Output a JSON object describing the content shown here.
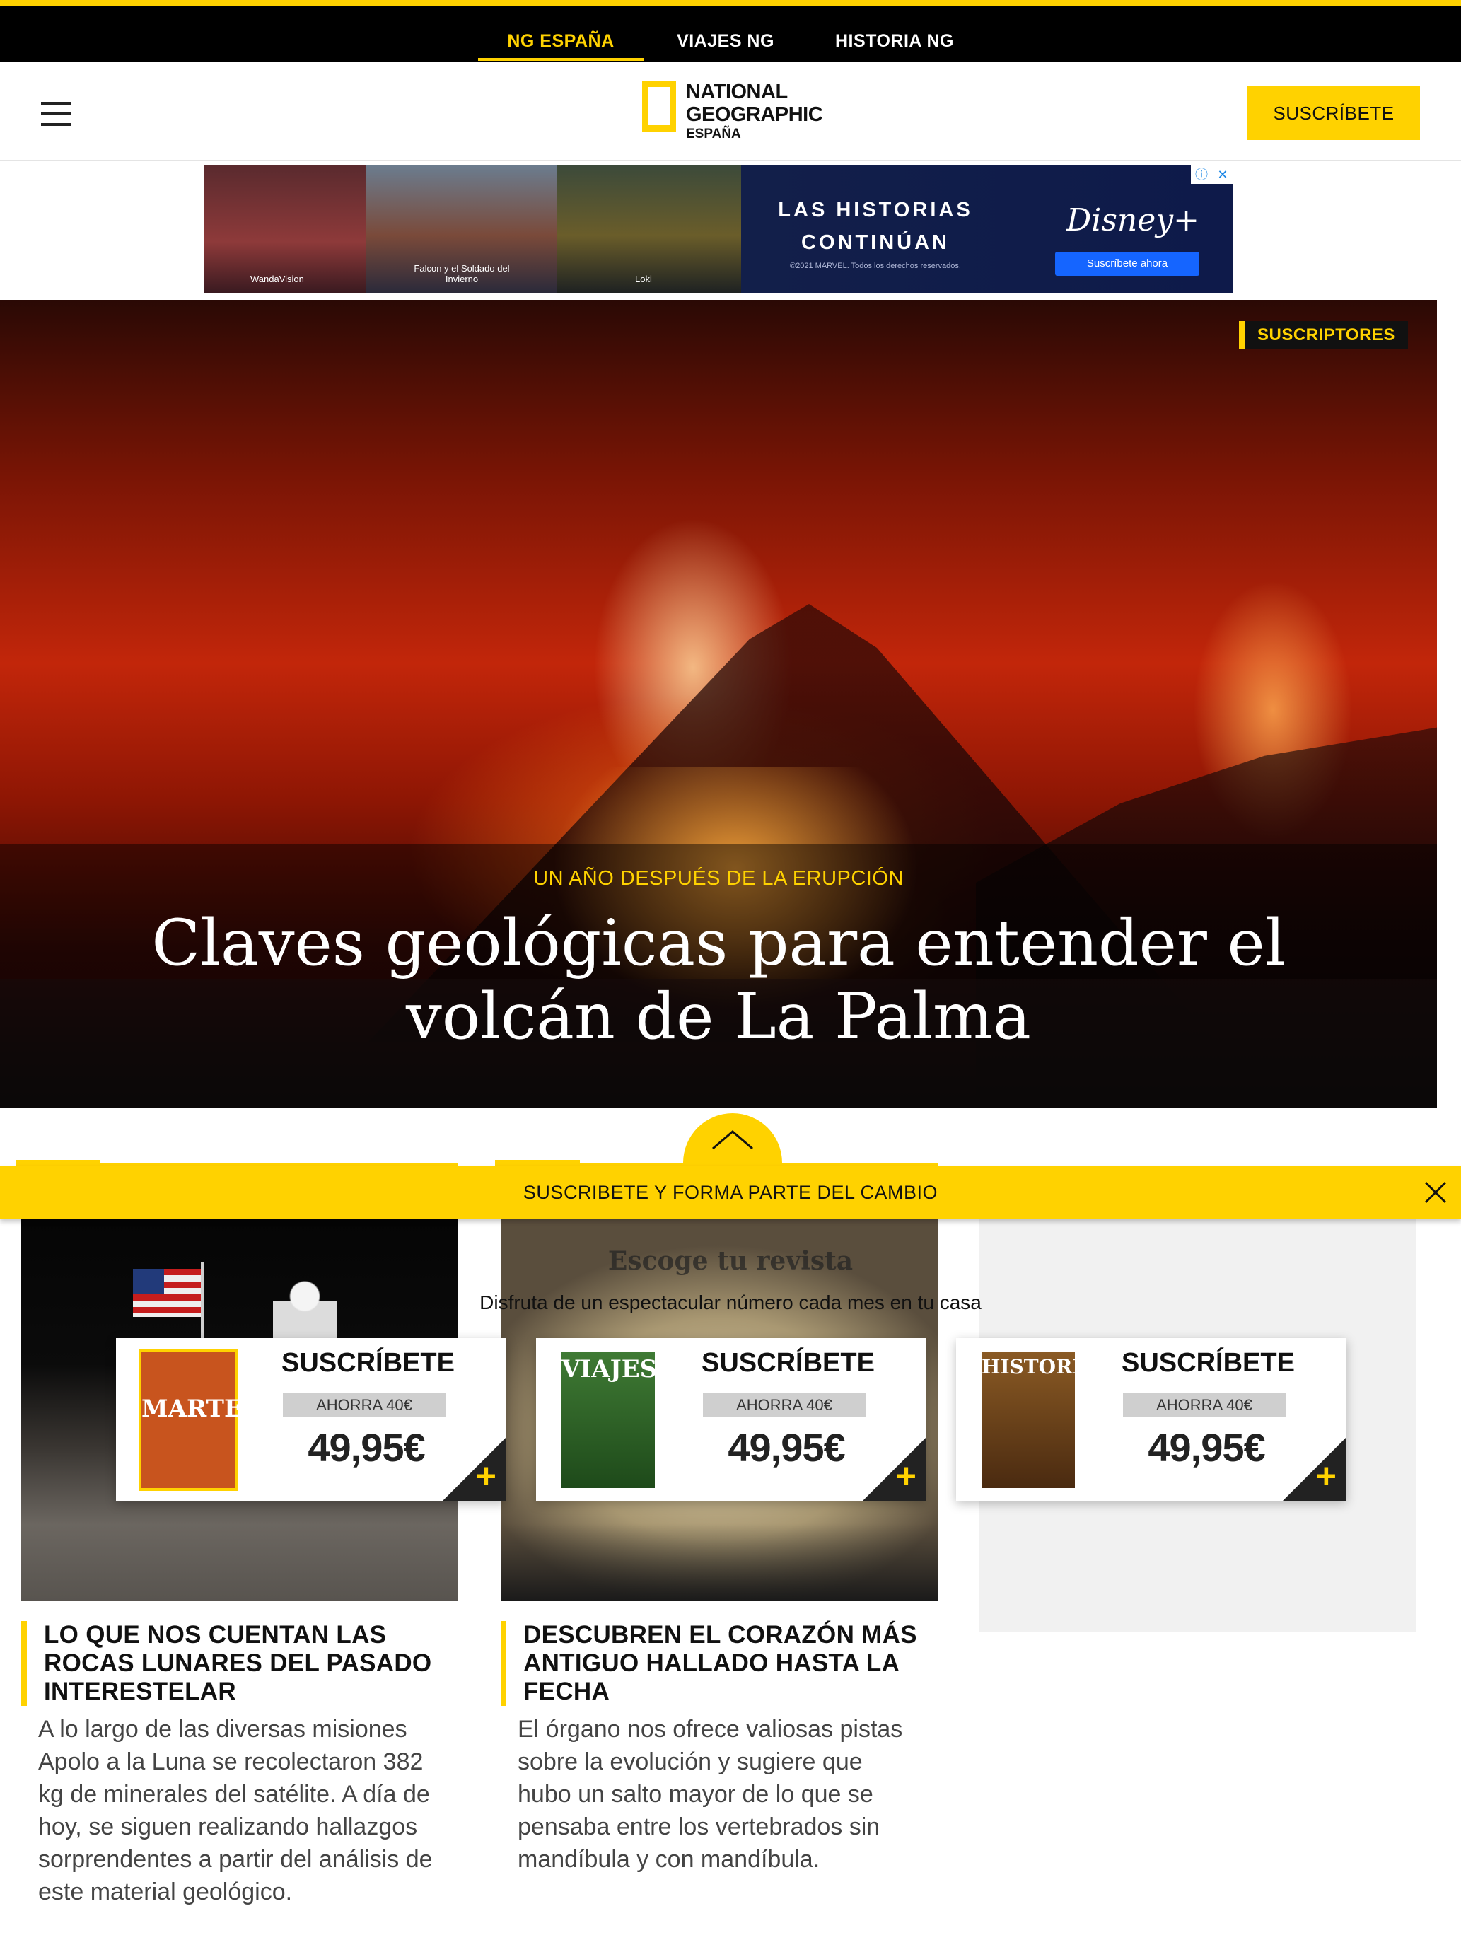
{
  "topbar": {
    "items": [
      {
        "label": "NG ESPAÑA",
        "active": true
      },
      {
        "label": "VIAJES NG",
        "active": false
      },
      {
        "label": "HISTORIA NG",
        "active": false
      }
    ]
  },
  "header": {
    "logo": {
      "line1": "NATIONAL",
      "line2": "GEOGRAPHIC",
      "line3": "ESPAÑA"
    },
    "subscribe_label": "SUSCRÍBETE"
  },
  "ad": {
    "captions": [
      "WandaVision",
      "Falcon y el Soldado del Invierno",
      "Loki"
    ],
    "headline": "LAS HISTORIAS CONTINÚAN",
    "legal": "©2021 MARVEL. Todos los derechos reservados.",
    "brand": "Disney+",
    "cta": "Suscríbete ahora"
  },
  "hero": {
    "badge": "SUSCRIPTORES",
    "kicker": "UN AÑO DESPUÉS DE LA ERUPCIÓN",
    "title": "Claves geológicas para entender el volcán de La Palma"
  },
  "promo": {
    "bar_text": "SUSCRIBETE Y FORMA PARTE DEL CAMBIO",
    "overlay_title": "Escoge tu revista",
    "overlay_subtitle": "Disfruta de un espectacular número cada mes en tu casa",
    "cards": [
      {
        "cover": "MARTE",
        "label": "SUSCRÍBETE",
        "save": "AHORRA 40€",
        "price": "49,95€",
        "cover_color": "#c8541e"
      },
      {
        "cover": "VIAJES",
        "label": "SUSCRÍBETE",
        "save": "AHORRA 40€",
        "price": "49,95€",
        "cover_color": "#2f6b2a"
      },
      {
        "cover": "HISTORIA",
        "label": "SUSCRÍBETE",
        "save": "AHORRA 40€",
        "price": "49,95€",
        "cover_color": "#7a4a1e"
      }
    ]
  },
  "articles": [
    {
      "title": "LO QUE NOS CUENTAN LAS ROCAS LUNARES DEL PASADO INTERESTELAR",
      "desc": "A lo largo de las diversas misiones Apolo a la Luna se recolectaron 382 kg de minerales del satélite. A día de hoy, se siguen realizando hallazgos sorprendentes a partir del análisis de este material geológico."
    },
    {
      "title": "DESCUBREN EL CORAZÓN MÁS ANTIGUO HALLADO HASTA LA FECHA",
      "desc": "El órgano nos ofrece valiosas pistas sobre la evolución y sugiere que hubo un salto mayor de lo que se pensaba entre los vertebrados sin mandíbula y con mandíbula."
    }
  ],
  "colors": {
    "brand_yellow": "#ffd200",
    "black": "#000000"
  }
}
